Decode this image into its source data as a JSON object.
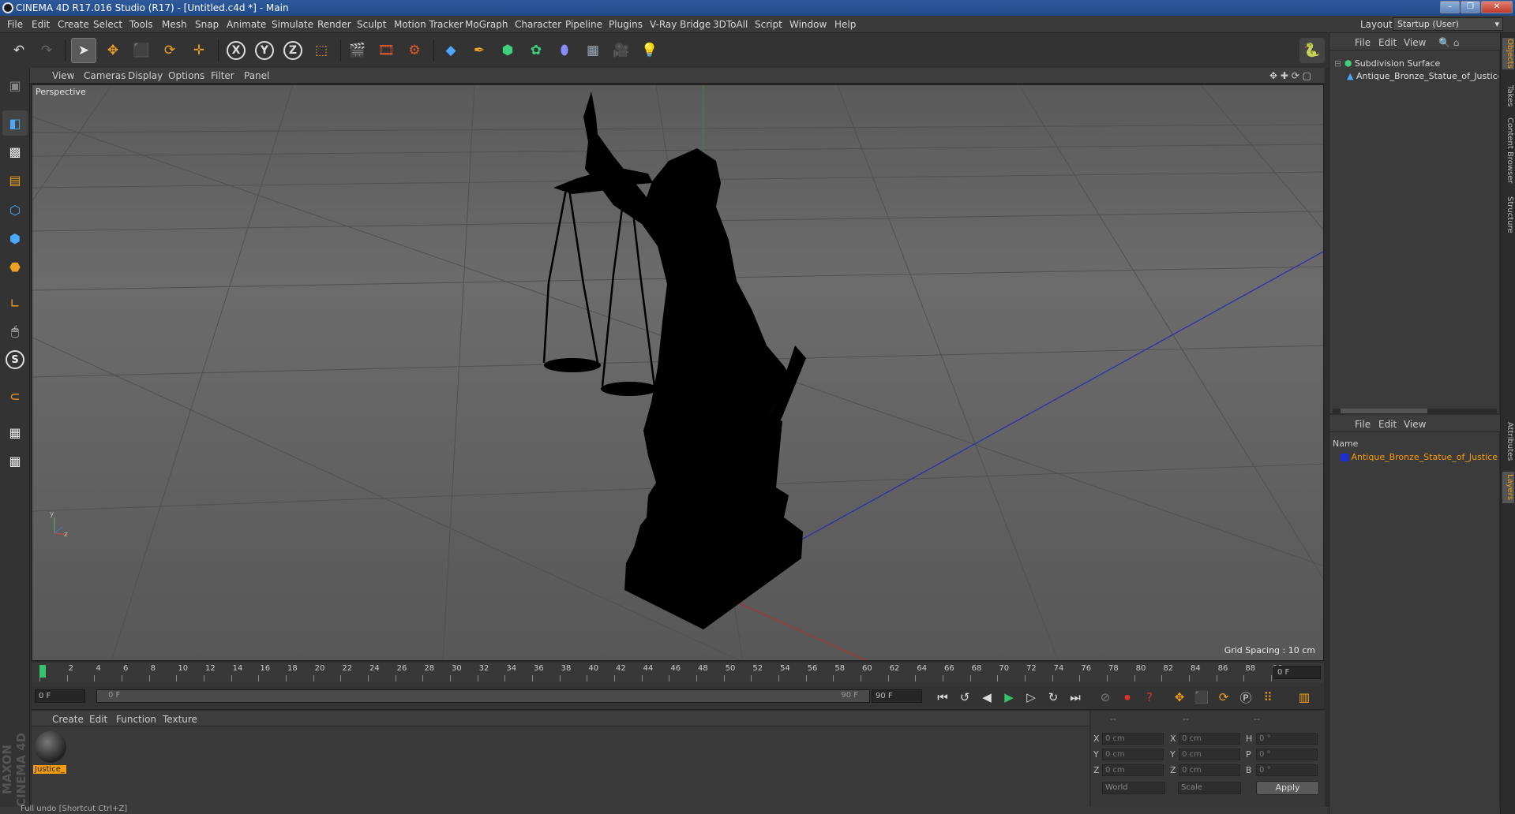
{
  "window": {
    "title": "CINEMA 4D R17.016 Studio (R17) - [Untitled.c4d *] - Main",
    "controls": [
      "–",
      "❐",
      "✕"
    ]
  },
  "menubar": {
    "items": [
      "File",
      "Edit",
      "Create",
      "Select",
      "Tools",
      "Mesh",
      "Snap",
      "Animate",
      "Simulate",
      "Render",
      "Sculpt",
      "Motion Tracker",
      "MoGraph",
      "Character",
      "Pipeline",
      "Plugins",
      "V-Ray Bridge",
      "3DToAll",
      "Script",
      "Window",
      "Help"
    ],
    "layout_label": "Layout:",
    "layout_value": "Startup (User)"
  },
  "toolbar": {
    "icons": [
      "undo-icon",
      "redo-icon",
      "select-arrow-icon",
      "move-icon",
      "scale-icon",
      "rotate-icon",
      "live-selection-icon",
      "x-axis-icon",
      "y-axis-icon",
      "z-axis-icon",
      "world-coordinates-icon",
      "render-view-icon",
      "render-picture-viewer-icon",
      "edit-render-settings-icon",
      "cube-icon",
      "pen-spline-icon",
      "subdivision-icon",
      "mograph-cloner-icon",
      "deformer-icon",
      "floor-icon",
      "camera-icon",
      "light-icon",
      "python-icon"
    ],
    "axis_labels": [
      "X",
      "Y",
      "Z"
    ]
  },
  "left_toolbar": {
    "icons": [
      "model-mode-icon",
      "texture-mode-icon",
      "workplane-icon",
      "points-mode-icon",
      "edges-mode-icon",
      "polygons-mode-icon",
      "axis-mode-icon",
      "tweak-icon",
      "snap-s-icon",
      "magnet-icon",
      "locked-workplane-icon",
      "planar-workplane-icon"
    ]
  },
  "viewport": {
    "menu": [
      "View",
      "Cameras",
      "Display",
      "Options",
      "Filter",
      "Panel"
    ],
    "label": "Perspective",
    "grid_spacing": "Grid Spacing : 10 cm",
    "axis_y": "y",
    "axis_z": "z"
  },
  "timeline": {
    "ticks": [
      "0",
      "2",
      "4",
      "6",
      "8",
      "10",
      "12",
      "14",
      "16",
      "18",
      "20",
      "22",
      "24",
      "26",
      "28",
      "30",
      "32",
      "34",
      "36",
      "38",
      "40",
      "42",
      "44",
      "46",
      "48",
      "50",
      "52",
      "54",
      "56",
      "58",
      "60",
      "62",
      "64",
      "66",
      "68",
      "70",
      "72",
      "74",
      "76",
      "78",
      "80",
      "82",
      "84",
      "86",
      "88",
      "90"
    ],
    "current_frame_display": "0 F"
  },
  "transport": {
    "start_frame": "0 F",
    "range_start": "0 F",
    "range_end": "90 F",
    "end_frame": "90 F"
  },
  "material_manager": {
    "menu": [
      "Create",
      "Edit",
      "Function",
      "Texture"
    ],
    "materials": [
      {
        "name": "Justice_"
      }
    ]
  },
  "coordinates": {
    "header": [
      "--",
      "--",
      "--"
    ],
    "rows": [
      {
        "l1": "X",
        "v1": "0 cm",
        "l2": "X",
        "v2": "0 cm",
        "l3": "H",
        "v3": "0 °"
      },
      {
        "l1": "Y",
        "v1": "0 cm",
        "l2": "Y",
        "v2": "0 cm",
        "l3": "P",
        "v3": "0 °"
      },
      {
        "l1": "Z",
        "v1": "0 cm",
        "l2": "Z",
        "v2": "0 cm",
        "l3": "B",
        "v3": "0 °"
      }
    ],
    "mode_world": "World",
    "mode_scale": "Scale",
    "apply_label": "Apply"
  },
  "object_manager": {
    "menu": [
      "File",
      "Edit",
      "View"
    ],
    "objects": [
      {
        "name": "Subdivision Surface",
        "level": 0
      },
      {
        "name": "Antique_Bronze_Statue_of_Justice",
        "level": 1
      }
    ]
  },
  "layer_manager": {
    "menu": [
      "File",
      "Edit",
      "View"
    ],
    "column_name": "Name",
    "layers": [
      {
        "name": "Antique_Bronze_Statue_of_Justice",
        "color": "#1a2fd0"
      }
    ]
  },
  "right_tabs": [
    "Objects",
    "Takes",
    "Content Browser",
    "Structure",
    "Attributes",
    "Layers"
  ],
  "branding": {
    "logo_text": "MAXON CINEMA 4D"
  },
  "status": {
    "text": "Full undo [Shortcut Ctrl+Z]"
  },
  "colors": {
    "accent_orange": "#f39c12",
    "selection_blue": "#3a6fd8",
    "timeline_marker": "#36c36e"
  }
}
